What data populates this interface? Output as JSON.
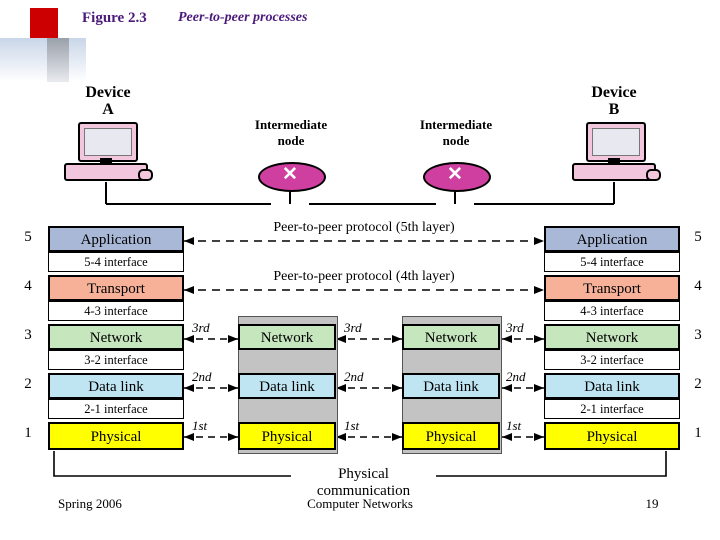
{
  "header": {
    "figure_label": "Figure 2.3",
    "figure_title": "Peer-to-peer processes"
  },
  "footer": {
    "left": "Spring 2006",
    "center": "Computer Networks",
    "right": "19"
  },
  "diagram": {
    "devices": [
      {
        "name": "device-a",
        "line1": "Device",
        "line2": "A"
      },
      {
        "name": "device-b",
        "line1": "Device",
        "line2": "B"
      }
    ],
    "intermediate_nodes": [
      {
        "line1": "Intermediate",
        "line2": "node",
        "glyph": "✕"
      },
      {
        "line1": "Intermediate",
        "line2": "node",
        "glyph": "✕"
      }
    ],
    "protocol_labels": [
      "Peer-to-peer protocol (5th layer)",
      "Peer-to-peer protocol (4th layer)"
    ],
    "hop_labels": [
      "3rd",
      "3rd",
      "3rd",
      "2nd",
      "2nd",
      "2nd",
      "1st",
      "1st",
      "1st"
    ],
    "bottom_label": "Physical communication",
    "layer_numbers_left": [
      "5",
      "4",
      "3",
      "2",
      "1"
    ],
    "layer_numbers_right": [
      "5",
      "4",
      "3",
      "2",
      "1"
    ],
    "end_stack": [
      {
        "label": "Application",
        "color": "#aab8d8"
      },
      {
        "label": "5-4 interface",
        "color": "#ffffff"
      },
      {
        "label": "Transport",
        "color": "#f7b199"
      },
      {
        "label": "4-3 interface",
        "color": "#ffffff"
      },
      {
        "label": "Network",
        "color": "#c6e6bd"
      },
      {
        "label": "3-2 interface",
        "color": "#ffffff"
      },
      {
        "label": "Data link",
        "color": "#bfe4f2"
      },
      {
        "label": "2-1 interface",
        "color": "#ffffff"
      },
      {
        "label": "Physical",
        "color": "#ffff00"
      }
    ],
    "middle_stack": [
      {
        "label": "Network",
        "color": "#c6e6bd"
      },
      {
        "label": "Data link",
        "color": "#bfe4f2"
      },
      {
        "label": "Physical",
        "color": "#ffff00"
      }
    ]
  }
}
